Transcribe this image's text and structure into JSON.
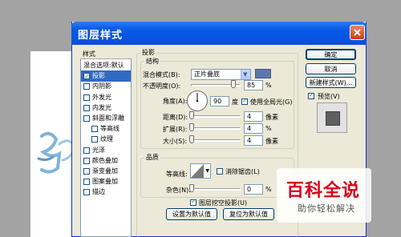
{
  "window": {
    "title": "图层样式"
  },
  "style_list": {
    "header": "样式",
    "items": [
      {
        "label": "混合选项:默认",
        "checkbox": false,
        "selected": false,
        "indent": 0
      },
      {
        "label": "投影",
        "checkbox": true,
        "checked": true,
        "selected": true,
        "indent": 0
      },
      {
        "label": "内阴影",
        "checkbox": true,
        "checked": false,
        "selected": false,
        "indent": 0
      },
      {
        "label": "外发光",
        "checkbox": true,
        "checked": false,
        "selected": false,
        "indent": 0
      },
      {
        "label": "内发光",
        "checkbox": true,
        "checked": false,
        "selected": false,
        "indent": 0
      },
      {
        "label": "斜面和浮雕",
        "checkbox": true,
        "checked": false,
        "selected": false,
        "indent": 0
      },
      {
        "label": "等高线",
        "checkbox": true,
        "checked": false,
        "selected": false,
        "indent": 1
      },
      {
        "label": "纹理",
        "checkbox": true,
        "checked": false,
        "selected": false,
        "indent": 1
      },
      {
        "label": "光泽",
        "checkbox": true,
        "checked": false,
        "selected": false,
        "indent": 0
      },
      {
        "label": "颜色叠加",
        "checkbox": true,
        "checked": false,
        "selected": false,
        "indent": 0
      },
      {
        "label": "渐变叠加",
        "checkbox": true,
        "checked": false,
        "selected": false,
        "indent": 0
      },
      {
        "label": "图案叠加",
        "checkbox": true,
        "checked": false,
        "selected": false,
        "indent": 0
      },
      {
        "label": "描边",
        "checkbox": true,
        "checked": false,
        "selected": false,
        "indent": 0
      }
    ]
  },
  "drop_shadow": {
    "section_title": "投影",
    "structure_title": "结构",
    "blend_mode_label": "混合模式(B):",
    "blend_mode_value": "正片叠底",
    "shadow_color": "#5a79aa",
    "opacity_label": "不透明度(O):",
    "opacity_value": "85",
    "opacity_fraction": 0.85,
    "percent": "%",
    "angle_label": "角度(A):",
    "angle_value": "90",
    "angle_unit": "度",
    "global_light_label": "使用全局光(G)",
    "global_light_checked": true,
    "distance_label": "距离(D):",
    "distance_value": "4",
    "spread_label": "扩展(R):",
    "spread_value": "4",
    "spread_unit": "%",
    "size_label": "大小(S):",
    "size_value": "4",
    "pixel_unit": "像素",
    "quality_title": "品质",
    "contour_label": "等高线:",
    "antialias_label": "消除锯齿(L)",
    "noise_label": "杂色(N):",
    "noise_value": "0",
    "knockout_label": "图层挖空投影(U)",
    "knockout_checked": true,
    "set_default_button": "设置为默认值",
    "reset_default_button": "复位为默认值"
  },
  "right_panel": {
    "ok_button": "确定",
    "cancel_button": "取消",
    "new_style_button": "新建样式(W)...",
    "preview_label": "预览(V)",
    "preview_checked": true
  },
  "watermark": {
    "main": "百科全说",
    "sub": "助你轻松解决",
    "color": "#d7001c"
  }
}
